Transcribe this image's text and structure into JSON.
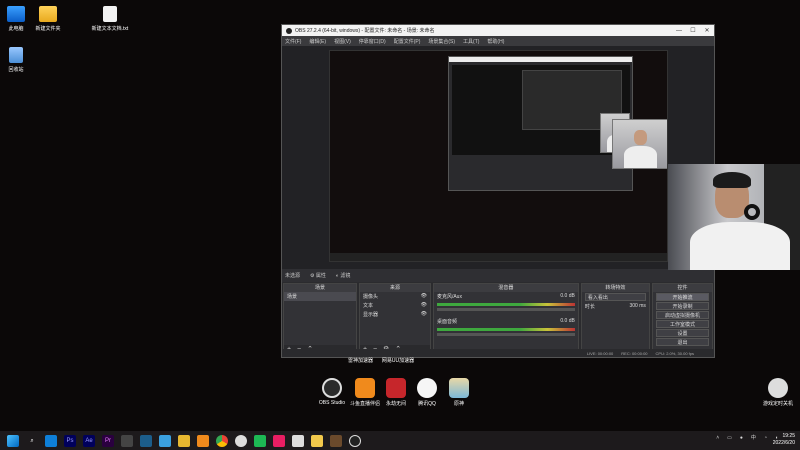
{
  "desktop": {
    "icons": [
      {
        "label": "此电脑"
      },
      {
        "label": "新建文件夹"
      },
      {
        "label": "新建文本文档.txt"
      },
      {
        "label": "回收站"
      }
    ],
    "caption_top": "雷神加速器",
    "caption_top2": "网易UU加速器",
    "apps": [
      {
        "label": "OBS Studio"
      },
      {
        "label": "斗鱼直播伴侣"
      },
      {
        "label": "永劫无间"
      },
      {
        "label": "腾讯QQ"
      },
      {
        "label": "原神"
      }
    ],
    "shutdown_label": "游戏定时关机"
  },
  "obs": {
    "title": "OBS 27.2.4 (64-bit, windows) - 配置文件: 未命名 - 场景: 未命名",
    "menu": [
      "文件(F)",
      "编辑(E)",
      "视图(V)",
      "停靠窗口(D)",
      "配置文件(P)",
      "场景集合(S)",
      "工具(T)",
      "帮助(H)"
    ],
    "status_row": {
      "no_source": "未选源",
      "props": "属性",
      "filters": "滤镜"
    },
    "docks": {
      "scenes": {
        "title": "场景",
        "items": [
          "场景"
        ]
      },
      "sources": {
        "title": "来源",
        "items": [
          "摄像头",
          "文本",
          "显示器"
        ]
      },
      "mixer": {
        "title": "混音器",
        "channels": [
          {
            "name": "麦克风/Aux",
            "db": "0.0 dB"
          },
          {
            "name": "桌面音频",
            "db": "0.0 dB"
          }
        ]
      },
      "transitions": {
        "title": "转场特效",
        "type": "看入看出",
        "duration_label": "时长",
        "duration": "300 ms"
      },
      "controls": {
        "title": "控件",
        "buttons": [
          "开始推流",
          "开始录制",
          "启动虚拟摄像机",
          "工作室模式",
          "设置",
          "退出"
        ]
      }
    },
    "statusbar": {
      "live": "LIVE: 00:00:00",
      "rec": "REC: 00:00:00",
      "cpu": "CPU: 2.0%, 30.00 fps"
    }
  },
  "taskbar": {
    "lang": "中",
    "time": "19:25",
    "date": "2022/6/20"
  }
}
